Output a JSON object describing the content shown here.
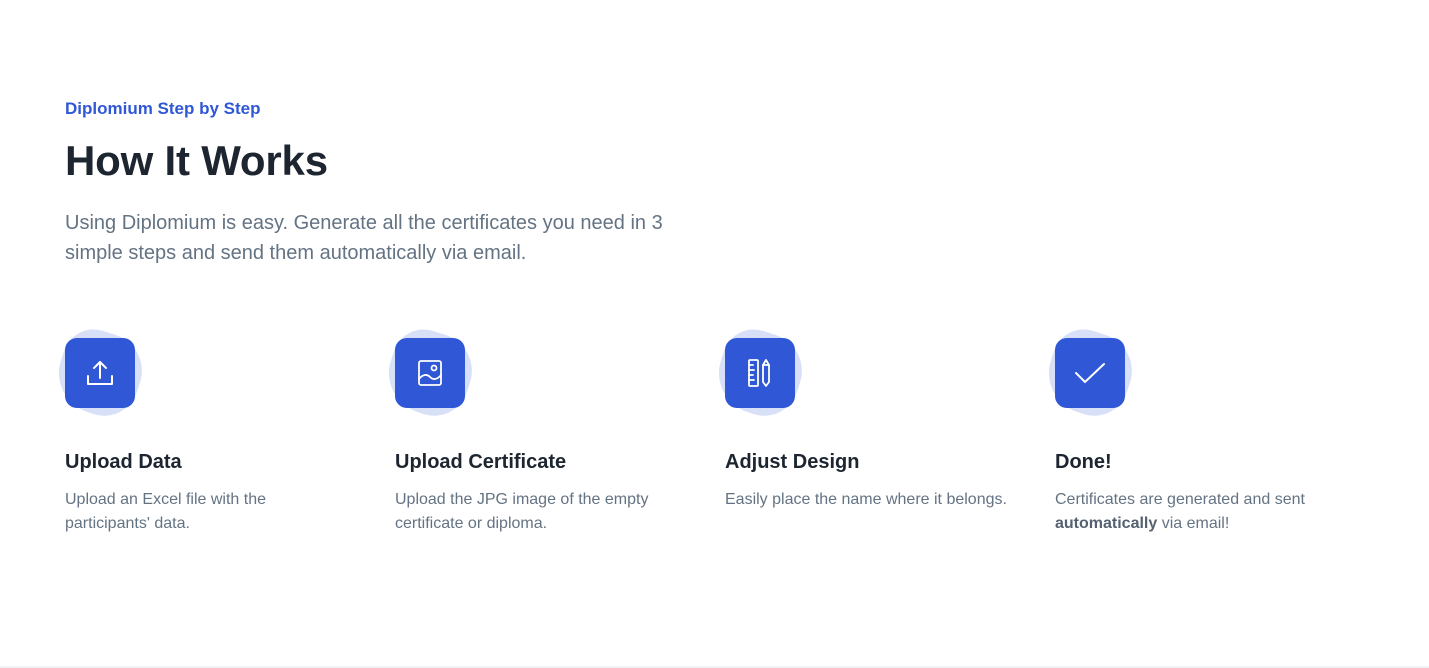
{
  "header": {
    "eyebrow": "Diplomium Step by Step",
    "title": "How It Works",
    "lead": "Using Diplomium is easy. Generate all the certificates you need in 3 simple steps and send them automatically via email."
  },
  "steps": [
    {
      "icon": "upload-icon",
      "title": "Upload Data",
      "text": "Upload an Excel file with the participants' data."
    },
    {
      "icon": "image-icon",
      "title": "Upload Certificate",
      "text": "Upload the JPG image of the empty certificate or diploma."
    },
    {
      "icon": "ruler-pencil-icon",
      "title": "Adjust Design",
      "text": "Easily place the name where it belongs."
    },
    {
      "icon": "check-icon",
      "title": "Done!",
      "text_before": "Certificates are generated and sent ",
      "text_bold": "automatically",
      "text_after": " via email!"
    }
  ],
  "colors": {
    "accent": "#2f57d6",
    "accent_soft": "#d8e0f8",
    "heading": "#1c2530",
    "body": "#647383"
  }
}
